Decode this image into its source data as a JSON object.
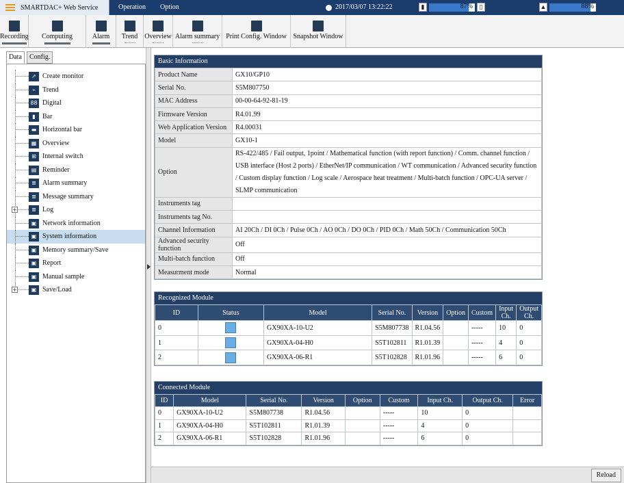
{
  "header": {
    "app_title": "SMARTDAC+ Web Service",
    "menu": [
      "Operation",
      "Option"
    ],
    "datetime": "2017/03/07 13:22:22",
    "meter1": {
      "percent_label": "87%",
      "fill": 0.87
    },
    "meter2": {
      "percent_label": "88%",
      "fill": 0.88
    }
  },
  "toolbar": {
    "items": [
      {
        "label": "Recording",
        "icon": "recording-icon"
      },
      {
        "label": "Computing",
        "icon": "computing-icon"
      },
      {
        "label": "Alarm",
        "icon": "alarm-icon"
      },
      {
        "label": "Trend",
        "icon": "trend-icon"
      },
      {
        "label": "Overview",
        "icon": "overview-icon"
      },
      {
        "label": "Alarm summary",
        "icon": "alarm-summary-icon"
      },
      {
        "label": "Print Config. Window",
        "icon": "printer-icon"
      },
      {
        "label": "Snapshot Window",
        "icon": "camera-icon"
      }
    ]
  },
  "sidebar": {
    "tabs": [
      "Data",
      "Config."
    ],
    "items": [
      {
        "label": "Create monitor",
        "icon": "cursor-icon"
      },
      {
        "label": "Trend",
        "icon": "trend-icon"
      },
      {
        "label": "Digital",
        "icon": "digital-icon"
      },
      {
        "label": "Bar",
        "icon": "bar-icon"
      },
      {
        "label": "Horizontal bar",
        "icon": "horizontal-bar-icon"
      },
      {
        "label": "Overview",
        "icon": "overview-icon"
      },
      {
        "label": "Internal switch",
        "icon": "switch-icon"
      },
      {
        "label": "Reminder",
        "icon": "reminder-icon"
      },
      {
        "label": "Alarm summary",
        "icon": "alarm-summary-icon"
      },
      {
        "label": "Message summary",
        "icon": "message-icon"
      },
      {
        "label": "Log",
        "icon": "log-icon"
      },
      {
        "label": "Network information",
        "icon": "network-icon"
      },
      {
        "label": "System information",
        "icon": "system-icon"
      },
      {
        "label": "Memory summary/Save",
        "icon": "memory-icon"
      },
      {
        "label": "Report",
        "icon": "report-icon"
      },
      {
        "label": "Manual sample",
        "icon": "sample-icon"
      },
      {
        "label": "Save/Load",
        "icon": "save-icon"
      }
    ]
  },
  "basic": {
    "title": "Basic Information",
    "rows": [
      {
        "k": "Product Name",
        "v": "GX10/GP10"
      },
      {
        "k": "Serial No.",
        "v": "S5M807750"
      },
      {
        "k": "MAC Address",
        "v": "00-00-64-92-81-19"
      },
      {
        "k": "Firmware Version",
        "v": "R4.01.99"
      },
      {
        "k": "Web Application Version",
        "v": "R4.00031"
      },
      {
        "k": "Model",
        "v": "GX10-1"
      },
      {
        "k": "Option",
        "v": "RS-422/485 / Fail output, 1point / Mathematical function (with report function) / Comm. channel function / USB interface (Host 2 ports) / EtherNet/IP communication / WT communication / Advanced security function / Custom display function / Log scale / Aerospace heat treatment / Multi-batch function / OPC-UA server / SLMP communication"
      },
      {
        "k": "Instruments tag",
        "v": ""
      },
      {
        "k": "Instruments tag No.",
        "v": ""
      },
      {
        "k": "Channel Information",
        "v": "AI 20Ch / DI 0Ch / Pulse 0Ch / AO 0Ch / DO 0Ch / PID 0Ch / Math 50Ch / Communication 50Ch"
      },
      {
        "k": "Advanced security function",
        "v": "Off"
      },
      {
        "k": "Multi-batch function",
        "v": "Off"
      },
      {
        "k": "Measurment mode",
        "v": "Normal"
      }
    ]
  },
  "recognized": {
    "title": "Recognized Module",
    "headers": [
      "ID",
      "Status",
      "Model",
      "Serial No.",
      "Version",
      "Option",
      "Custom",
      "Input Ch.",
      "Output Ch."
    ],
    "rows": [
      {
        "id": "0",
        "model": "GX90XA-10-U2",
        "serial": "S5M807738",
        "version": "R1.04.56",
        "option": "",
        "custom": "-----",
        "input": "10",
        "output": "0"
      },
      {
        "id": "1",
        "model": "GX90XA-04-H0",
        "serial": "S5T102811",
        "version": "R1.01.39",
        "option": "",
        "custom": "-----",
        "input": "4",
        "output": "0"
      },
      {
        "id": "2",
        "model": "GX90XA-06-R1",
        "serial": "S5T102828",
        "version": "R1.01.96",
        "option": "",
        "custom": "-----",
        "input": "6",
        "output": "0"
      }
    ]
  },
  "connected": {
    "title": "Connected Module",
    "headers": [
      "ID",
      "Model",
      "Serial No.",
      "Version",
      "Option",
      "Custom",
      "Input Ch.",
      "Output Ch.",
      "Error"
    ],
    "rows": [
      {
        "id": "0",
        "model": "GX90XA-10-U2",
        "serial": "S5M807738",
        "version": "R1.04.56",
        "option": "",
        "custom": "-----",
        "input": "10",
        "output": "0",
        "error": ""
      },
      {
        "id": "1",
        "model": "GX90XA-04-H0",
        "serial": "S5T102811",
        "version": "R1.01.39",
        "option": "",
        "custom": "-----",
        "input": "4",
        "output": "0",
        "error": ""
      },
      {
        "id": "2",
        "model": "GX90XA-06-R1",
        "serial": "S5T102828",
        "version": "R1.01.96",
        "option": "",
        "custom": "-----",
        "input": "6",
        "output": "0",
        "error": ""
      }
    ]
  },
  "footer": {
    "reload_label": "Reload"
  }
}
